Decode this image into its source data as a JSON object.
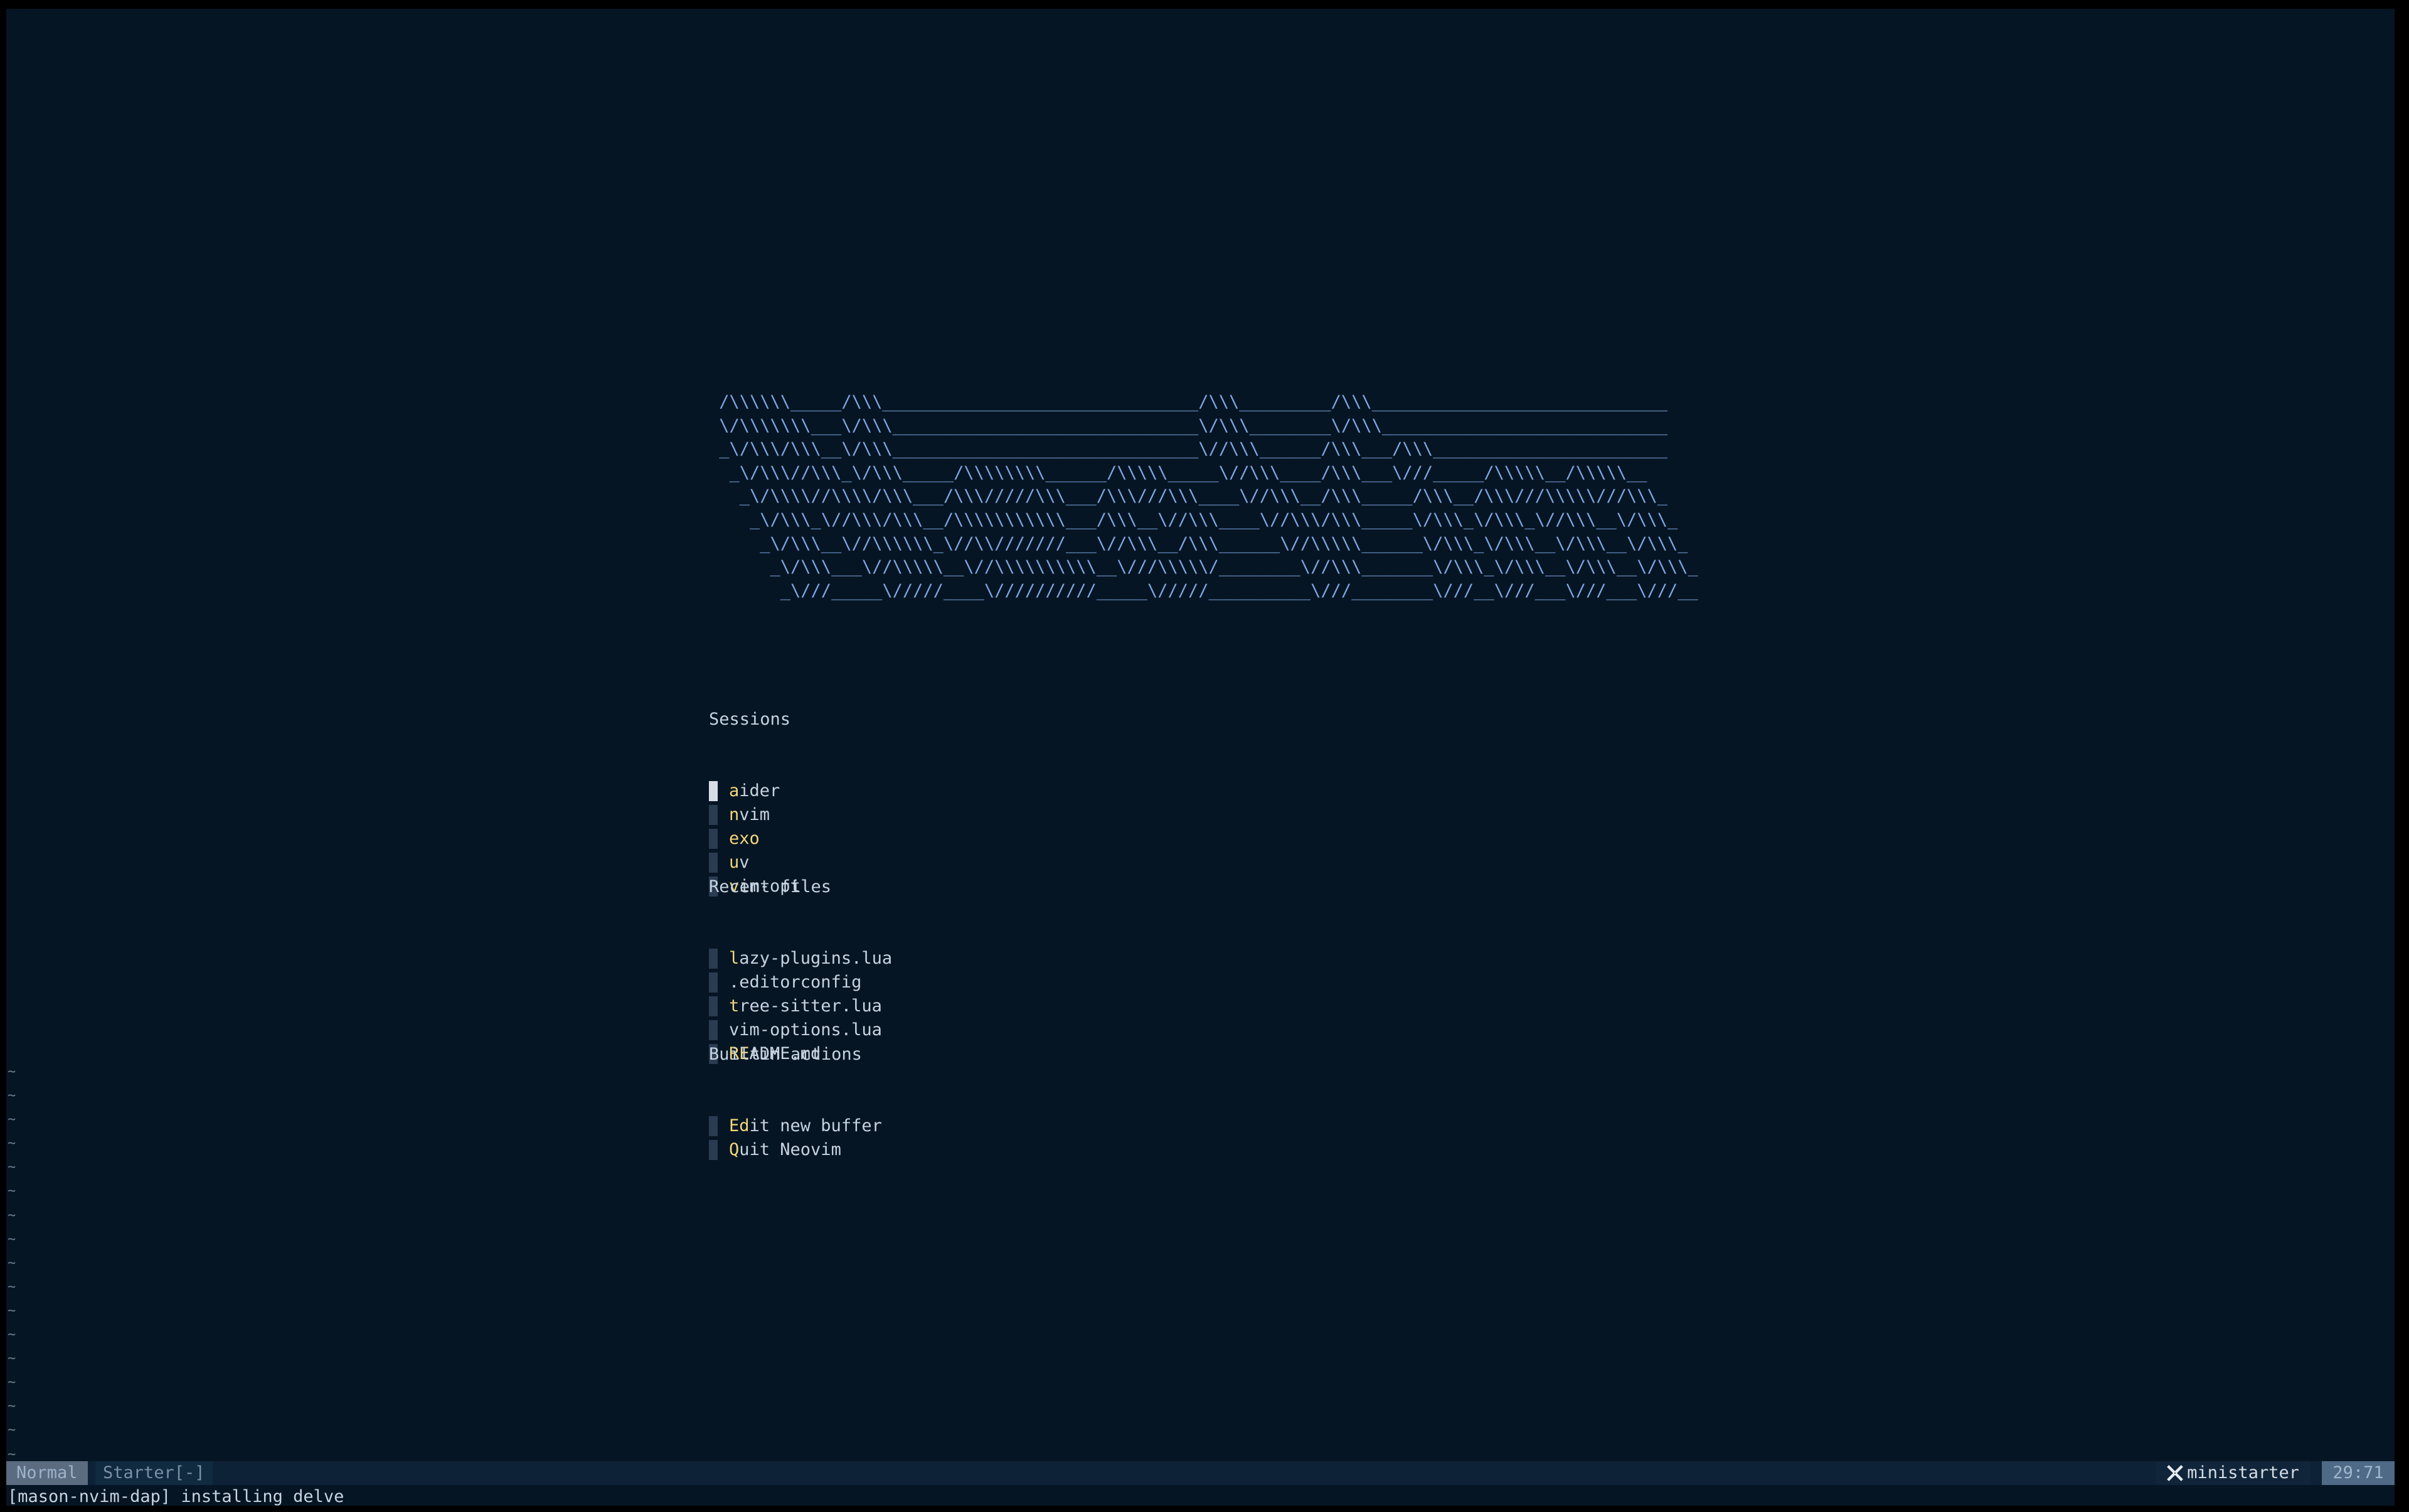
{
  "banner": {
    "lines": [
      " /\\\\\\\\\\\\_____/\\\\\\_______________________________/\\\\\\_________/\\\\\\_____________________________",
      " \\/\\\\\\\\\\\\\\___\\/\\\\\\______________________________\\/\\\\\\________\\/\\\\\\____________________________",
      " _\\/\\\\\\/\\\\\\__\\/\\\\\\______________________________\\//\\\\\\______/\\\\\\___/\\\\\\_______________________",
      "  _\\/\\\\\\//\\\\\\_\\/\\\\\\_____/\\\\\\\\\\\\\\\\______/\\\\\\\\\\_____\\//\\\\\\____/\\\\\\___\\///_____/\\\\\\\\\\__/\\\\\\\\\\__",
      "   _\\/\\\\\\\\//\\\\\\\\/\\\\\\___/\\\\\\/////\\\\\\___/\\\\\\///\\\\\\____\\//\\\\\\__/\\\\\\_____/\\\\\\__/\\\\\\///\\\\\\\\\\///\\\\\\_",
      "    _\\/\\\\\\_\\//\\\\\\/\\\\\\__/\\\\\\\\\\\\\\\\\\\\\\___/\\\\\\__\\//\\\\\\____\\//\\\\\\/\\\\\\_____\\/\\\\\\_\\/\\\\\\_\\//\\\\\\__\\/\\\\\\_",
      "     _\\/\\\\\\__\\//\\\\\\\\\\\\_\\//\\\\///////___\\//\\\\\\__/\\\\\\______\\//\\\\\\\\\\______\\/\\\\\\_\\/\\\\\\__\\/\\\\\\__\\/\\\\\\_",
      "      _\\/\\\\\\___\\//\\\\\\\\\\__\\//\\\\\\\\\\\\\\\\\\\\__\\///\\\\\\\\\\/________\\//\\\\\\_______\\/\\\\\\_\\/\\\\\\__\\/\\\\\\__\\/\\\\\\_",
      "       _\\///_____\\/////____\\//////////_____\\/////__________\\///________\\///__\\///___\\///___\\///__"
    ]
  },
  "sections": {
    "sessions": {
      "title": "Sessions",
      "items": [
        {
          "q": "a",
          "rest": "ider"
        },
        {
          "q": "n",
          "rest": "vim"
        },
        {
          "q": "exo",
          "rest": ""
        },
        {
          "q": "u",
          "rest": "v"
        },
        {
          "q": "v",
          "rest": "im-opt"
        }
      ]
    },
    "recent": {
      "title": "Recent files",
      "items": [
        {
          "q": "l",
          "rest": "azy-plugins.lua"
        },
        {
          "q": "",
          "rest": ".editorconfig"
        },
        {
          "q": "t",
          "rest": "ree-sitter.lua"
        },
        {
          "q": "",
          "rest": "vim-options.lua"
        },
        {
          "q": "RE",
          "rest": "ADME.md"
        }
      ]
    },
    "builtin": {
      "title": "Builtin actions",
      "items": [
        {
          "q": "Ed",
          "rest": "it new buffer"
        },
        {
          "q": "Q",
          "rest": "uit Neovim"
        }
      ]
    }
  },
  "tildes": "~\n~\n~\n~\n~\n~\n~\n~\n~\n~\n~\n~\n~\n~\n~\n~\n~",
  "statusline": {
    "mode": "Normal",
    "buffer": "Starter[-]",
    "filetype": "ministarter",
    "filetype_icon": "ministarter-icon",
    "location": "29:71"
  },
  "cmdline": "[mason-nvim-dap] installing delve",
  "colors": {
    "background": "#061523",
    "banner": "#7fa8e6",
    "query_highlight": "#f2d77c",
    "text": "#c7d3e0"
  }
}
